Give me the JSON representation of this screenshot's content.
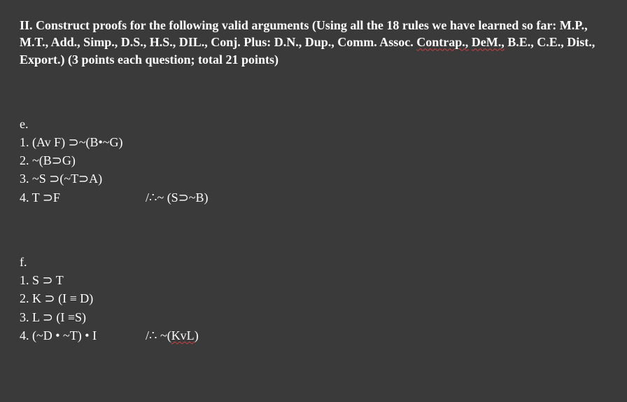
{
  "header": {
    "part1": "II.  Construct proofs for the following valid arguments (Using all the 18 rules we have learned so far: M.P., M.T., Add., Simp., D.S., H.S., DIL., Conj. Plus: D.N., Dup., Comm. Assoc. ",
    "contrap": "Contrap.,",
    "part2": " ",
    "dem": "DeM.,",
    "part3": " B.E., C.E., Dist., Export.) (3 points each question; total 21 points)"
  },
  "problem_e": {
    "label": "e.",
    "premises": [
      "1. (Av F) ⊃~(B•~G)",
      "2. ~(B⊃G)",
      "3. ~S ⊃(~T⊃A)"
    ],
    "last_premise": "4. T ⊃F",
    "conclusion": "/∴~ (S⊃~B)"
  },
  "problem_f": {
    "label": "f.",
    "premises": [
      "1. S  ⊃ T",
      "2. K ⊃ (I ≡ D)",
      "3. L ⊃ (I ≡S)"
    ],
    "last_premise": "4. (~D • ~T) • I",
    "conclusion_prefix": "/∴  ~(",
    "conclusion_underlined": "KvL",
    "conclusion_suffix": ")"
  }
}
